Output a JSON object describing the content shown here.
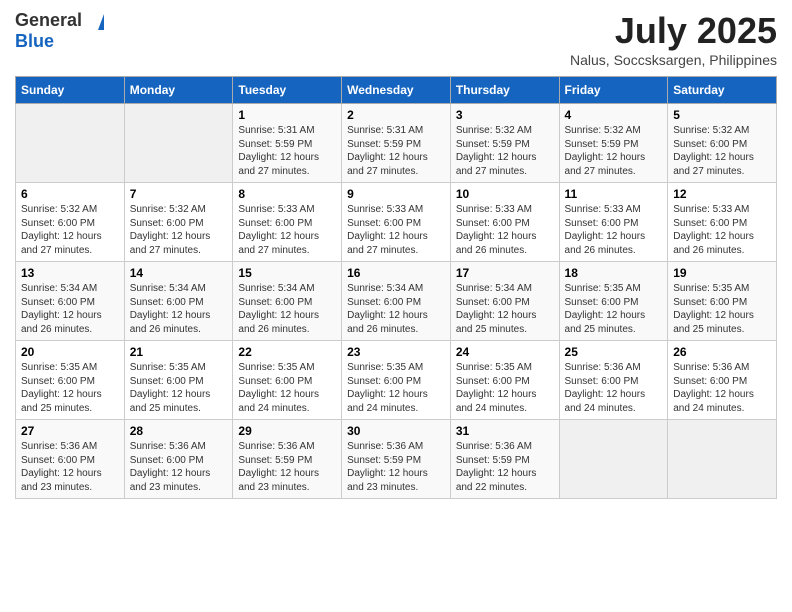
{
  "header": {
    "logo_general": "General",
    "logo_blue": "Blue",
    "month_year": "July 2025",
    "location": "Nalus, Soccsksargen, Philippines"
  },
  "days_of_week": [
    "Sunday",
    "Monday",
    "Tuesday",
    "Wednesday",
    "Thursday",
    "Friday",
    "Saturday"
  ],
  "weeks": [
    [
      {
        "day": "",
        "sunrise": "",
        "sunset": "",
        "daylight": ""
      },
      {
        "day": "",
        "sunrise": "",
        "sunset": "",
        "daylight": ""
      },
      {
        "day": "1",
        "sunrise": "Sunrise: 5:31 AM",
        "sunset": "Sunset: 5:59 PM",
        "daylight": "Daylight: 12 hours and 27 minutes."
      },
      {
        "day": "2",
        "sunrise": "Sunrise: 5:31 AM",
        "sunset": "Sunset: 5:59 PM",
        "daylight": "Daylight: 12 hours and 27 minutes."
      },
      {
        "day": "3",
        "sunrise": "Sunrise: 5:32 AM",
        "sunset": "Sunset: 5:59 PM",
        "daylight": "Daylight: 12 hours and 27 minutes."
      },
      {
        "day": "4",
        "sunrise": "Sunrise: 5:32 AM",
        "sunset": "Sunset: 5:59 PM",
        "daylight": "Daylight: 12 hours and 27 minutes."
      },
      {
        "day": "5",
        "sunrise": "Sunrise: 5:32 AM",
        "sunset": "Sunset: 6:00 PM",
        "daylight": "Daylight: 12 hours and 27 minutes."
      }
    ],
    [
      {
        "day": "6",
        "sunrise": "Sunrise: 5:32 AM",
        "sunset": "Sunset: 6:00 PM",
        "daylight": "Daylight: 12 hours and 27 minutes."
      },
      {
        "day": "7",
        "sunrise": "Sunrise: 5:32 AM",
        "sunset": "Sunset: 6:00 PM",
        "daylight": "Daylight: 12 hours and 27 minutes."
      },
      {
        "day": "8",
        "sunrise": "Sunrise: 5:33 AM",
        "sunset": "Sunset: 6:00 PM",
        "daylight": "Daylight: 12 hours and 27 minutes."
      },
      {
        "day": "9",
        "sunrise": "Sunrise: 5:33 AM",
        "sunset": "Sunset: 6:00 PM",
        "daylight": "Daylight: 12 hours and 27 minutes."
      },
      {
        "day": "10",
        "sunrise": "Sunrise: 5:33 AM",
        "sunset": "Sunset: 6:00 PM",
        "daylight": "Daylight: 12 hours and 26 minutes."
      },
      {
        "day": "11",
        "sunrise": "Sunrise: 5:33 AM",
        "sunset": "Sunset: 6:00 PM",
        "daylight": "Daylight: 12 hours and 26 minutes."
      },
      {
        "day": "12",
        "sunrise": "Sunrise: 5:33 AM",
        "sunset": "Sunset: 6:00 PM",
        "daylight": "Daylight: 12 hours and 26 minutes."
      }
    ],
    [
      {
        "day": "13",
        "sunrise": "Sunrise: 5:34 AM",
        "sunset": "Sunset: 6:00 PM",
        "daylight": "Daylight: 12 hours and 26 minutes."
      },
      {
        "day": "14",
        "sunrise": "Sunrise: 5:34 AM",
        "sunset": "Sunset: 6:00 PM",
        "daylight": "Daylight: 12 hours and 26 minutes."
      },
      {
        "day": "15",
        "sunrise": "Sunrise: 5:34 AM",
        "sunset": "Sunset: 6:00 PM",
        "daylight": "Daylight: 12 hours and 26 minutes."
      },
      {
        "day": "16",
        "sunrise": "Sunrise: 5:34 AM",
        "sunset": "Sunset: 6:00 PM",
        "daylight": "Daylight: 12 hours and 26 minutes."
      },
      {
        "day": "17",
        "sunrise": "Sunrise: 5:34 AM",
        "sunset": "Sunset: 6:00 PM",
        "daylight": "Daylight: 12 hours and 25 minutes."
      },
      {
        "day": "18",
        "sunrise": "Sunrise: 5:35 AM",
        "sunset": "Sunset: 6:00 PM",
        "daylight": "Daylight: 12 hours and 25 minutes."
      },
      {
        "day": "19",
        "sunrise": "Sunrise: 5:35 AM",
        "sunset": "Sunset: 6:00 PM",
        "daylight": "Daylight: 12 hours and 25 minutes."
      }
    ],
    [
      {
        "day": "20",
        "sunrise": "Sunrise: 5:35 AM",
        "sunset": "Sunset: 6:00 PM",
        "daylight": "Daylight: 12 hours and 25 minutes."
      },
      {
        "day": "21",
        "sunrise": "Sunrise: 5:35 AM",
        "sunset": "Sunset: 6:00 PM",
        "daylight": "Daylight: 12 hours and 25 minutes."
      },
      {
        "day": "22",
        "sunrise": "Sunrise: 5:35 AM",
        "sunset": "Sunset: 6:00 PM",
        "daylight": "Daylight: 12 hours and 24 minutes."
      },
      {
        "day": "23",
        "sunrise": "Sunrise: 5:35 AM",
        "sunset": "Sunset: 6:00 PM",
        "daylight": "Daylight: 12 hours and 24 minutes."
      },
      {
        "day": "24",
        "sunrise": "Sunrise: 5:35 AM",
        "sunset": "Sunset: 6:00 PM",
        "daylight": "Daylight: 12 hours and 24 minutes."
      },
      {
        "day": "25",
        "sunrise": "Sunrise: 5:36 AM",
        "sunset": "Sunset: 6:00 PM",
        "daylight": "Daylight: 12 hours and 24 minutes."
      },
      {
        "day": "26",
        "sunrise": "Sunrise: 5:36 AM",
        "sunset": "Sunset: 6:00 PM",
        "daylight": "Daylight: 12 hours and 24 minutes."
      }
    ],
    [
      {
        "day": "27",
        "sunrise": "Sunrise: 5:36 AM",
        "sunset": "Sunset: 6:00 PM",
        "daylight": "Daylight: 12 hours and 23 minutes."
      },
      {
        "day": "28",
        "sunrise": "Sunrise: 5:36 AM",
        "sunset": "Sunset: 6:00 PM",
        "daylight": "Daylight: 12 hours and 23 minutes."
      },
      {
        "day": "29",
        "sunrise": "Sunrise: 5:36 AM",
        "sunset": "Sunset: 5:59 PM",
        "daylight": "Daylight: 12 hours and 23 minutes."
      },
      {
        "day": "30",
        "sunrise": "Sunrise: 5:36 AM",
        "sunset": "Sunset: 5:59 PM",
        "daylight": "Daylight: 12 hours and 23 minutes."
      },
      {
        "day": "31",
        "sunrise": "Sunrise: 5:36 AM",
        "sunset": "Sunset: 5:59 PM",
        "daylight": "Daylight: 12 hours and 22 minutes."
      },
      {
        "day": "",
        "sunrise": "",
        "sunset": "",
        "daylight": ""
      },
      {
        "day": "",
        "sunrise": "",
        "sunset": "",
        "daylight": ""
      }
    ]
  ]
}
